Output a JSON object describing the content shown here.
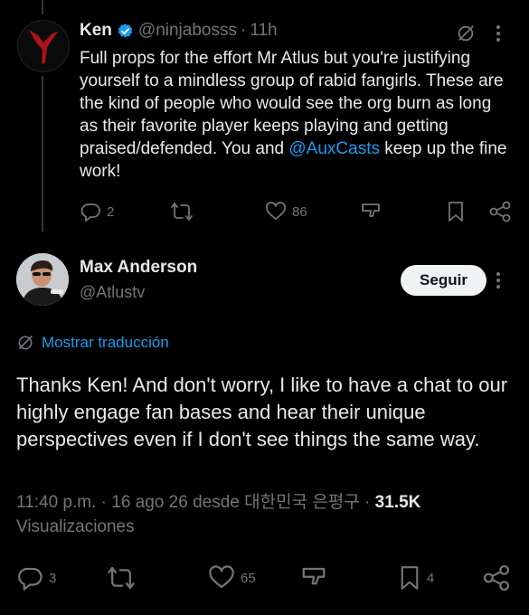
{
  "reply_tweet": {
    "author_name": "Ken",
    "handle": "@ninjabosss",
    "time": "11h",
    "text_before_mention": "Full props for the effort Mr Atlus but you're justifying yourself to a mindless group of rabid fangirls. These are the kind of people who would see the org burn as long as their favorite player keeps playing and getting praised/defended. You and ",
    "mention": "@AuxCasts",
    "text_after_mention": " keep up the fine work!",
    "replies": "2",
    "likes": "86"
  },
  "main_tweet": {
    "author_name": "Max Anderson",
    "handle": "@Atlustv",
    "follow_label": "Seguir",
    "translate_label": "Mostrar traducción",
    "text": "Thanks Ken! And don't worry, I like to have a chat to our highly engage fan bases and hear their unique perspectives even if I don't see things the same way.",
    "time": "11:40 p.m.",
    "date": "16 ago 26",
    "location": "desde 대한민국 은평구",
    "views_count": "31.5K",
    "views_label": "Visualizaciones",
    "replies": "3",
    "likes": "65",
    "bookmarks": "4"
  },
  "colors": {
    "accent": "#1d9bf0",
    "muted": "#71767b",
    "background": "#000000",
    "text": "#e7e9ea",
    "ken_logo": "#b0121b"
  },
  "icons": [
    "verified-badge-icon",
    "grok-icon",
    "more-icon",
    "reply-icon",
    "repost-icon",
    "like-icon",
    "views-icon",
    "bookmark-icon",
    "share-icon",
    "translate-icon"
  ]
}
